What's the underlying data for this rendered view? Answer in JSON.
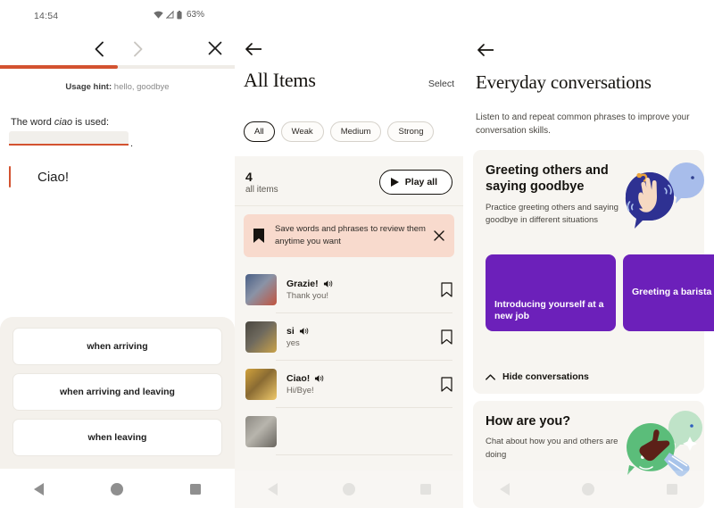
{
  "status_bar": {
    "time": "14:54",
    "battery_percent": "63%",
    "icons": [
      "wifi-icon",
      "signal-icon",
      "battery-icon"
    ]
  },
  "left_panel": {
    "nav": {
      "prev_icon": "chevron-left-icon",
      "next_icon": "chevron-right-icon",
      "close_icon": "close-icon"
    },
    "progress": {
      "percent": 50,
      "fill_color": "#d35230",
      "track_color": "#efece7"
    },
    "usage_hint_label": "Usage hint:",
    "usage_hint_value": " hello, goodbye",
    "question_prefix": "The word ",
    "question_italic": "ciao",
    "question_suffix": " is used:",
    "blank_value": "",
    "blank_trailing": ".",
    "answer_text": "Ciao!",
    "answer_bar_color": "#d35230",
    "options": [
      {
        "label": "when arriving"
      },
      {
        "label": "when arriving and leaving"
      },
      {
        "label": "when leaving"
      }
    ]
  },
  "middle_panel": {
    "back_icon": "arrow-left-icon",
    "title": "All Items",
    "select_label": "Select",
    "filters": [
      {
        "label": "All",
        "active": true
      },
      {
        "label": "Weak",
        "active": false
      },
      {
        "label": "Medium",
        "active": false
      },
      {
        "label": "Strong",
        "active": false
      }
    ],
    "count_number": "4",
    "count_label": "all items",
    "play_all_label": "Play all",
    "play_icon": "play-icon",
    "banner": {
      "icon": "bookmark-filled-icon",
      "text": "Save words and phrases to review them anytime you want",
      "close_icon": "close-icon",
      "background": "#f8dacd"
    },
    "items": [
      {
        "title": "Grazie!",
        "subtitle": "Thank you!",
        "audio_icon": "speaker-icon",
        "bookmark_icon": "bookmark-outline-icon",
        "thumb_colors": [
          "#4a5f86",
          "#8a93a6",
          "#c2543f"
        ]
      },
      {
        "title": "si",
        "subtitle": "yes",
        "audio_icon": "speaker-icon",
        "bookmark_icon": "bookmark-outline-icon",
        "thumb_colors": [
          "#4a4740",
          "#6f6a5e",
          "#c9a24a"
        ]
      },
      {
        "title": "Ciao!",
        "subtitle": "Hi/Bye!",
        "audio_icon": "speaker-icon",
        "bookmark_icon": "bookmark-outline-icon",
        "thumb_colors": [
          "#d1a23c",
          "#8a6b33",
          "#efc96b"
        ]
      },
      {
        "title": "",
        "subtitle": "",
        "audio_icon": "speaker-icon",
        "bookmark_icon": "bookmark-outline-icon",
        "thumb_colors": [
          "#8d8a83",
          "#b8b5ad",
          "#6a665f"
        ]
      }
    ]
  },
  "right_panel": {
    "back_icon": "arrow-left-icon",
    "title": "Everyday conversations",
    "subtitle": "Listen to and repeat common phrases to improve your conversation skills.",
    "cards": [
      {
        "heading": "Greeting others and saying goodbye",
        "paragraph": "Practice greeting others and saying goodbye in different situations",
        "illustration": "waving-hand-illustration",
        "tiles": [
          {
            "label": "Introducing yourself at a new job",
            "color": "#6c20ba"
          },
          {
            "label": "Greeting a barista",
            "color": "#6c20ba"
          }
        ],
        "toggle_label": "Hide conversations",
        "toggle_icon": "chevron-up-icon"
      },
      {
        "heading": "How are you?",
        "paragraph": "Chat about how you and others are doing",
        "illustration": "thumbs-up-illustration"
      }
    ]
  },
  "android_nav": {
    "back_icon": "nav-back-icon",
    "home_icon": "nav-home-icon",
    "recents_icon": "nav-recents-icon"
  }
}
